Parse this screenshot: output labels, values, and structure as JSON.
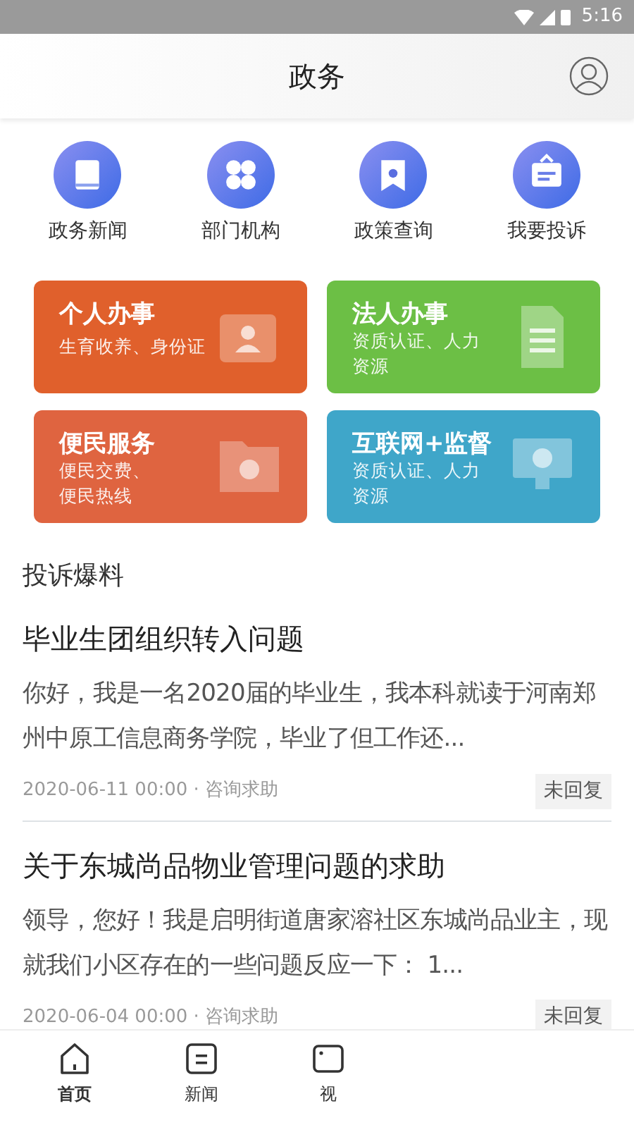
{
  "status_bar": {
    "time": "5:16"
  },
  "header": {
    "title": "政务"
  },
  "shortcuts": [
    {
      "label": "政务新闻",
      "kind": "book"
    },
    {
      "label": "部门机构",
      "kind": "grid"
    },
    {
      "label": "政策查询",
      "kind": "ribbon"
    },
    {
      "label": "我要投诉",
      "kind": "board"
    }
  ],
  "service_cards": [
    {
      "title": "个人办事",
      "subtitle_lines": [
        "生育收养、身份证"
      ],
      "color": "#e0602c",
      "kind": "person"
    },
    {
      "title": "法人办事",
      "subtitle_lines": [
        "资质认证、人力",
        "资源"
      ],
      "color": "#6cbf45",
      "kind": "document"
    },
    {
      "title": "便民服务",
      "subtitle_lines": [
        "便民交费、",
        "便民热线"
      ],
      "color": "#df6440",
      "kind": "folder"
    },
    {
      "title": "互联网+监督",
      "subtitle_lines": [
        "资质认证、人力",
        "资源"
      ],
      "color": "#3fa6c9",
      "kind": "monitor"
    }
  ],
  "section": {
    "title": "投诉爆料"
  },
  "posts": [
    {
      "title": "毕业生团组织转入问题",
      "excerpt": " 你好，我是一名2020届的毕业生，我本科就读于河南郑州中原工信息商务学院，毕业了但工作还...",
      "meta": "2020-06-11 00:00 · 咨询求助",
      "status": "未回复"
    },
    {
      "title": "关于东城尚品物业管理问题的求助",
      "excerpt": "领导，您好！我是启明街道唐家溶社区东城尚品业主，现就我们小区存在的一些问题反应一下： 1...",
      "meta": "2020-06-04 00:00 · 咨询求助",
      "status": "未回复"
    }
  ],
  "tab_bar": [
    {
      "label": "首页",
      "kind": "home",
      "selected": true
    },
    {
      "label": "新闻",
      "kind": "news",
      "selected": false
    },
    {
      "label": "视",
      "kind": "video",
      "selected": false
    }
  ]
}
